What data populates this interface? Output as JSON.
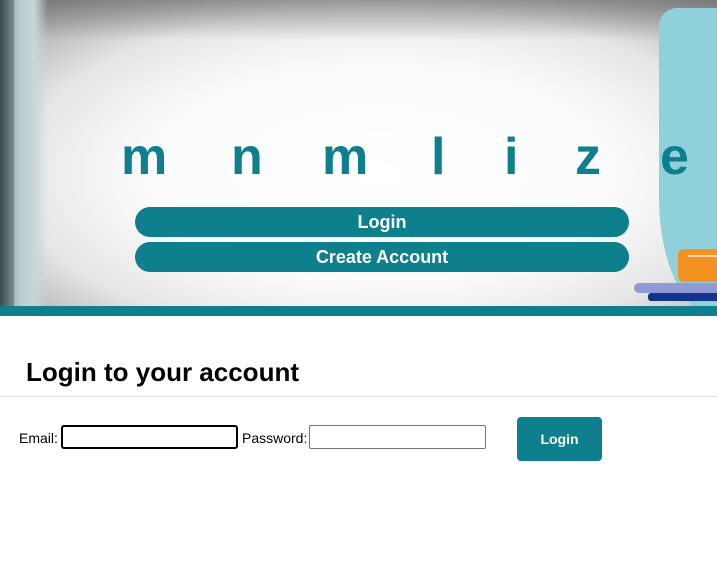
{
  "brand": {
    "letters": [
      "m",
      "n",
      "m",
      "l",
      "i",
      "z",
      "e"
    ]
  },
  "hero": {
    "login_label": "Login",
    "create_account_label": "Create Account"
  },
  "login_form": {
    "title": "Login to your account",
    "email_label": "Email:",
    "email_value": "",
    "password_label": "Password:",
    "password_value": "",
    "submit_label": "Login"
  },
  "colors": {
    "accent": "#0d7f8d",
    "hero_side_panel": "#8fd0da",
    "book_orange": "#f39222",
    "book_lavender": "#8f9ad6",
    "book_navy": "#14348c"
  }
}
